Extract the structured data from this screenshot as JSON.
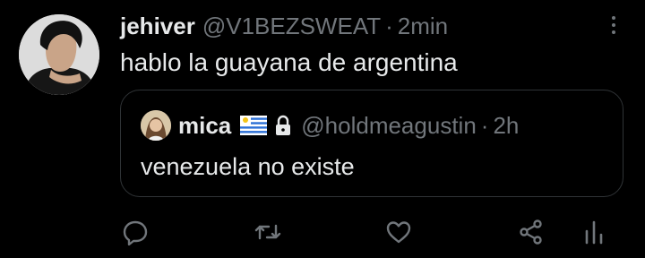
{
  "tweet": {
    "display_name": "jehiver",
    "handle": "@V1BEZSWEAT",
    "separator": "·",
    "time": "2min",
    "text": "hablo la guayana de argentina"
  },
  "quoted": {
    "display_name": "mica",
    "handle": "@holdmeagustin",
    "separator": "·",
    "time": "2h",
    "text": "venezuela no existe"
  },
  "icons": {
    "more": "more-vertical-icon",
    "flag": "uruguay-flag-icon",
    "lock": "lock-icon",
    "reply": "reply-icon",
    "retweet": "retweet-icon",
    "like": "heart-icon",
    "share": "share-icon",
    "analytics": "analytics-icon"
  },
  "colors": {
    "background": "#000000",
    "text": "#e7e9ea",
    "muted": "#71767b",
    "border": "#2f3336"
  }
}
